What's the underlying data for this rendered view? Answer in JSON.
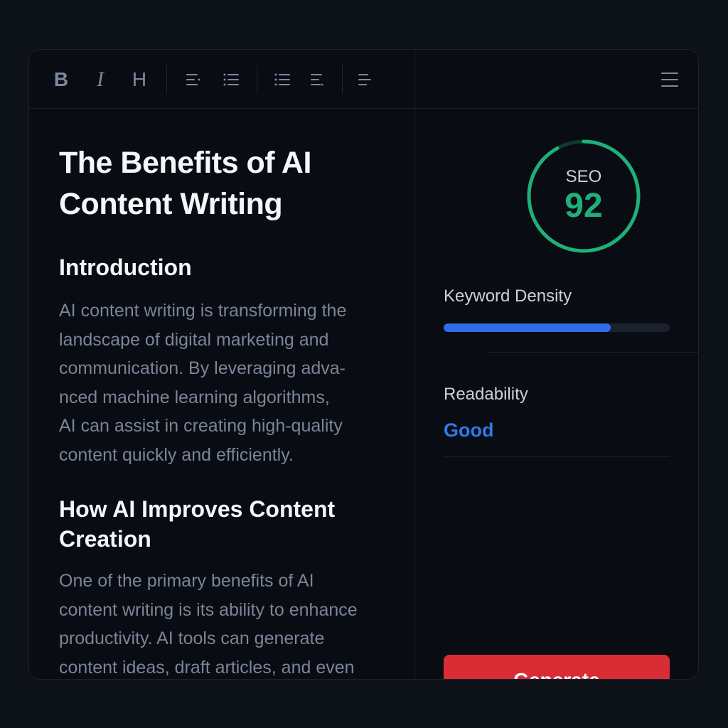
{
  "toolbar": {
    "bold_label": "B",
    "italic_label": "I",
    "heading_label": "H",
    "tools": [
      "align-left-icon",
      "bullet-list-icon",
      "bullet-list-icon",
      "align-right-icon",
      "align-left-icon",
      "menu-icon"
    ]
  },
  "document": {
    "title": "The Benefits of AI\nContent Writing",
    "sections": [
      {
        "heading": "Introduction",
        "body": "AI content writing is transforming the\nlandscape of digital marketing and\ncommunication. By leveraging adva-\nnced machine learning algorithms,\nAI can assist in creating high-quality\ncontent quickly and efficiently."
      },
      {
        "heading": "How AI Improves Content\nCreation",
        "body": "One of the primary benefits of AI\ncontent writing is its ability to enhance\nproductivity. AI tools can generate\ncontent ideas, draft articles, and even"
      }
    ]
  },
  "seo": {
    "label": "SEO",
    "score": "92",
    "score_fraction": 0.92,
    "color": "#1fb07a"
  },
  "keyword_density": {
    "label": "Keyword Density",
    "fraction": 0.74,
    "color": "#2f6ee8"
  },
  "readability": {
    "label": "Readability",
    "value": "Good",
    "color": "#2f7ae9"
  },
  "generate": {
    "label": "Generate",
    "color": "#d92d35"
  }
}
